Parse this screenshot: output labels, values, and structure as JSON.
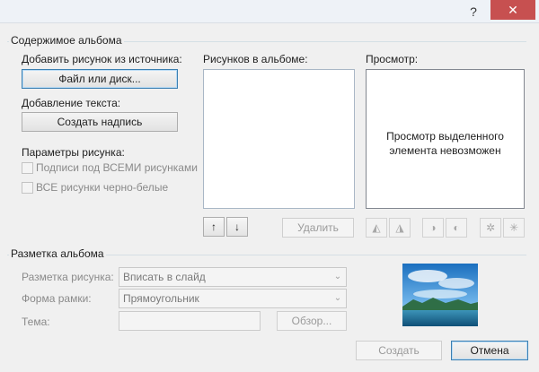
{
  "titlebar": {
    "help_glyph": "?",
    "close_glyph": "✕"
  },
  "album_content": {
    "group_title": "Содержимое альбома",
    "insert_from_label": "Добавить рисунок из источника:",
    "file_disk_button": "Файл или диск...",
    "insert_text_label": "Добавление текста:",
    "new_textbox_button": "Создать надпись",
    "picture_options_label": "Параметры рисунка:",
    "captions_checkbox": "Подписи под ВСЕМИ рисунками",
    "bw_checkbox": "ВСЕ рисунки черно-белые",
    "pictures_in_album_label": "Рисунков в альбоме:",
    "move_up_glyph": "↑",
    "move_down_glyph": "↓",
    "remove_button": "Удалить",
    "preview_label": "Просмотр:",
    "preview_message": "Просмотр выделенного элемента невозможен"
  },
  "album_layout": {
    "group_title": "Разметка альбома",
    "picture_layout_label": "Разметка рисунка:",
    "picture_layout_value": "Вписать в слайд",
    "frame_shape_label": "Форма рамки:",
    "frame_shape_value": "Прямоугольник",
    "theme_label": "Тема:",
    "theme_value": "",
    "browse_button": "Обзор..."
  },
  "footer": {
    "create_button": "Создать",
    "cancel_button": "Отмена"
  },
  "colors": {
    "accent": "#3c7fb1",
    "close": "#c75050"
  }
}
